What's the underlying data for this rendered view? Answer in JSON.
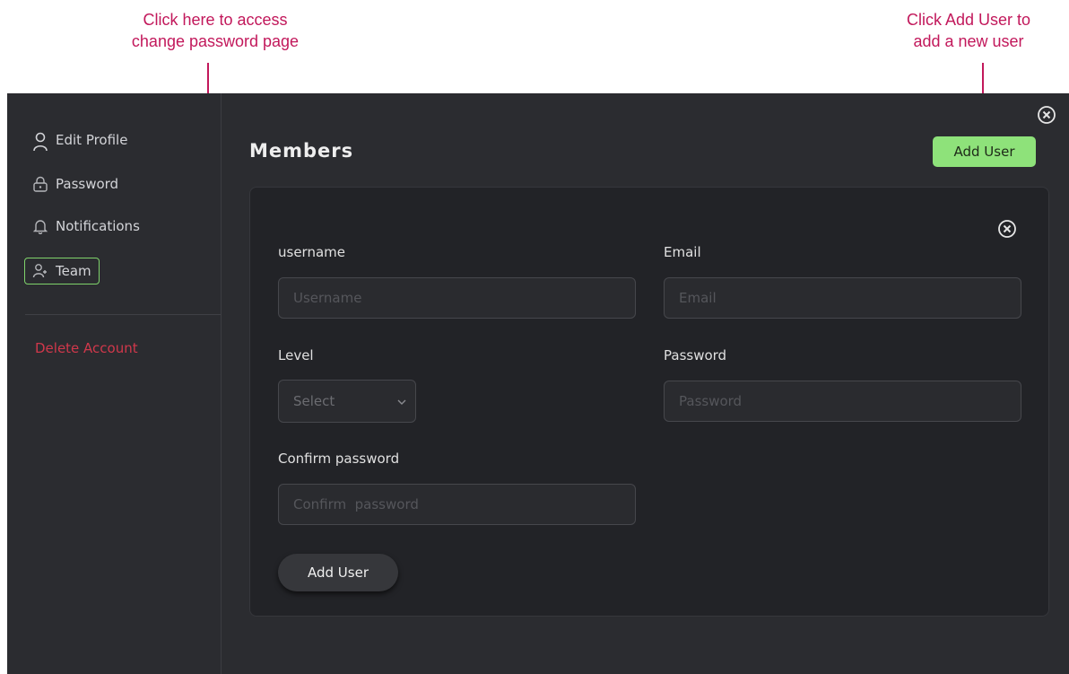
{
  "annotations": {
    "left": [
      "Click here to access",
      "change password page"
    ],
    "right": [
      "Click Add User to",
      "add a new user"
    ],
    "color": "#c2185b"
  },
  "sidebar": {
    "items": [
      {
        "label": "Edit Profile",
        "icon": "user-icon"
      },
      {
        "label": "Password",
        "icon": "lock-icon"
      },
      {
        "label": "Notifications",
        "icon": "bell-icon"
      },
      {
        "label": "Team",
        "icon": "team-icon",
        "active": true
      }
    ],
    "delete_label": "Delete Account"
  },
  "main": {
    "title": "Members",
    "add_user_label": "Add User",
    "form": {
      "username_label": "username",
      "username_placeholder": "Username",
      "email_label": "Email",
      "email_placeholder": "Email",
      "level_label": "Level",
      "level_selected": "Select",
      "password_label": "Password",
      "password_placeholder": "Password",
      "confirm_label": "Confirm password",
      "confirm_placeholder": "Confirm  password",
      "submit_label": "Add User"
    }
  },
  "colors": {
    "accent_green": "#8ee27a",
    "danger": "#d0384b",
    "background": "#2b2c30",
    "card": "#222327"
  }
}
